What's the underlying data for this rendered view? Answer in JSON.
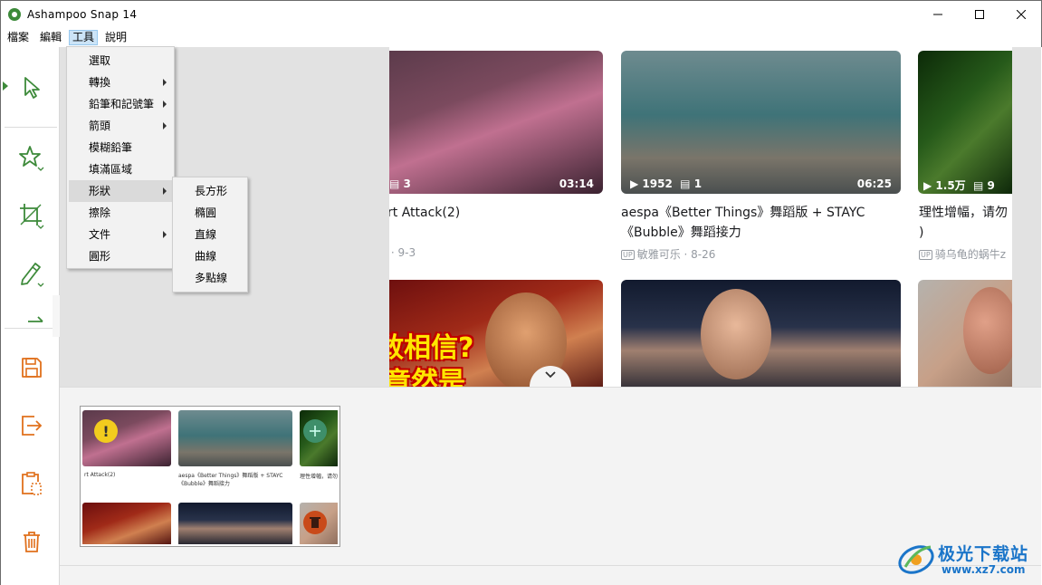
{
  "window": {
    "title": "Ashampoo Snap 14",
    "minimize_symbol": "—",
    "maximize_symbol": "☐",
    "close_symbol": "✕"
  },
  "menubar": [
    {
      "label": "檔案"
    },
    {
      "label": "編輯"
    },
    {
      "label": "工具"
    },
    {
      "label": "說明"
    }
  ],
  "tools_menu": {
    "items": [
      {
        "label": "選取",
        "submenu": false
      },
      {
        "label": "轉換",
        "submenu": true
      },
      {
        "label": "鉛筆和記號筆",
        "submenu": true
      },
      {
        "label": "箭頭",
        "submenu": true
      },
      {
        "label": "模糊鉛筆",
        "submenu": false
      },
      {
        "label": "填滿區域",
        "submenu": false
      },
      {
        "label": "形狀",
        "submenu": true,
        "highlighted": true
      },
      {
        "label": "擦除",
        "submenu": false
      },
      {
        "label": "文件",
        "submenu": true
      },
      {
        "label": "圓形",
        "submenu": false
      }
    ]
  },
  "shape_menu": {
    "items": [
      {
        "label": "長方形"
      },
      {
        "label": "橢圓"
      },
      {
        "label": "直線"
      },
      {
        "label": "曲線"
      },
      {
        "label": "多點線"
      }
    ]
  },
  "sidebar_icons": [
    "select-arrow-icon",
    "star-icon",
    "crop-icon",
    "pencil-icon",
    "save-icon",
    "export-icon",
    "clipboard-icon",
    "trash-icon"
  ],
  "colors": {
    "accent": "#e0701c",
    "tool_green": "#3d8a3a",
    "menu_highlight": "#dadada"
  },
  "screenshot": {
    "videos": [
      {
        "duration": "03:14",
        "views": "",
        "danmaku": "3",
        "title": "rt Attack(2)",
        "meta": "/ · 9-3"
      },
      {
        "duration": "06:25",
        "views": "1952",
        "danmaku": "1",
        "title_line1": "aespa《Better Things》舞蹈版 + STAYC",
        "title_line2": "《Bubble》舞蹈接力",
        "author": "敏雅可乐",
        "date": "8-26"
      },
      {
        "views": "1.5万",
        "danmaku": "9",
        "title_line1": "理性增幅，请勿",
        "title_line2": ")",
        "author": "骑乌龟的蜗牛z"
      }
    ],
    "sticker_line1": "敢相信?",
    "sticker_line2": "竟然是",
    "up_badge": "UP"
  },
  "watermark": {
    "brand": "极光下载站",
    "url": "www.xz7.com"
  }
}
